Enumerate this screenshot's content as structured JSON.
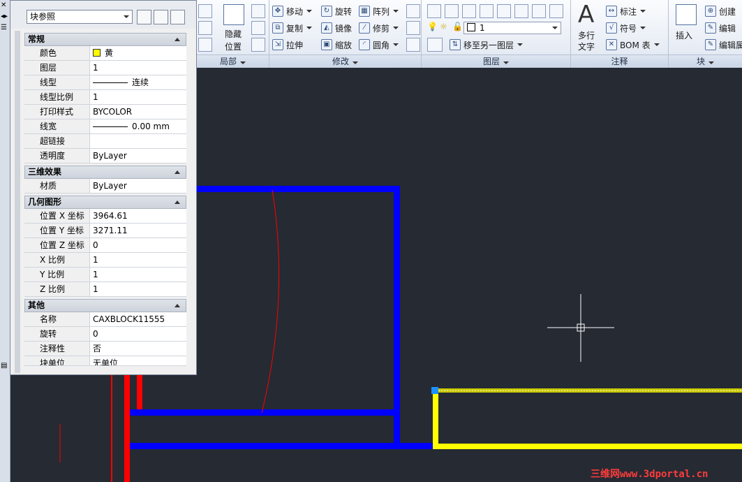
{
  "ribbon": {
    "local": {
      "hide_label": "隐藏",
      "position_label": "位置",
      "panel_label": "局部"
    },
    "modify": {
      "move": "移动",
      "rotate": "旋转",
      "array": "阵列",
      "copy": "复制",
      "mirror": "镜像",
      "trim": "修剪",
      "stretch": "拉伸",
      "scale": "缩放",
      "fillet": "圆角",
      "panel_label": "修改"
    },
    "layers": {
      "current_layer": "1",
      "move_to_layer": "移至另一图层",
      "panel_label": "图层"
    },
    "annotation": {
      "mtext_line1": "多行",
      "mtext_line2": "文字",
      "dimension": "标注",
      "symbol": "符号",
      "bom": "BOM 表",
      "panel_label": "注释"
    },
    "block": {
      "insert": "插入",
      "create": "创建",
      "edit": "编辑",
      "edit_attr": "编辑属",
      "panel_label": "块"
    }
  },
  "properties": {
    "selector": "块参照",
    "sections": [
      {
        "title": "常规",
        "rows": [
          {
            "key": "颜色",
            "value": "黄"
          },
          {
            "key": "图层",
            "value": "1"
          },
          {
            "key": "线型",
            "value": "连续"
          },
          {
            "key": "线型比例",
            "value": "1"
          },
          {
            "key": "打印样式",
            "value": "BYCOLOR"
          },
          {
            "key": "线宽",
            "value": "0.00 mm"
          },
          {
            "key": "超链接",
            "value": ""
          },
          {
            "key": "透明度",
            "value": "ByLayer"
          }
        ]
      },
      {
        "title": "三维效果",
        "rows": [
          {
            "key": "材质",
            "value": "ByLayer"
          }
        ]
      },
      {
        "title": "几何图形",
        "rows": [
          {
            "key": "位置 X 坐标",
            "value": "3964.61"
          },
          {
            "key": "位置 Y 坐标",
            "value": "3271.11"
          },
          {
            "key": "位置 Z 坐标",
            "value": "0"
          },
          {
            "key": "X 比例",
            "value": "1"
          },
          {
            "key": "Y 比例",
            "value": "1"
          },
          {
            "key": "Z 比例",
            "value": "1"
          }
        ]
      },
      {
        "title": "其他",
        "rows": [
          {
            "key": "名称",
            "value": "CAXBLOCK11555"
          },
          {
            "key": "旋转",
            "value": "0"
          },
          {
            "key": "注释性",
            "value": "否"
          },
          {
            "key": "块单位",
            "value": "无单位"
          }
        ]
      }
    ]
  },
  "colors": {
    "canvas": "#252a33",
    "blue_line": "#0000ff",
    "yellow_line": "#ffff00",
    "red_line": "#ff0000"
  },
  "watermark": "三维网www.3dportal.cn"
}
